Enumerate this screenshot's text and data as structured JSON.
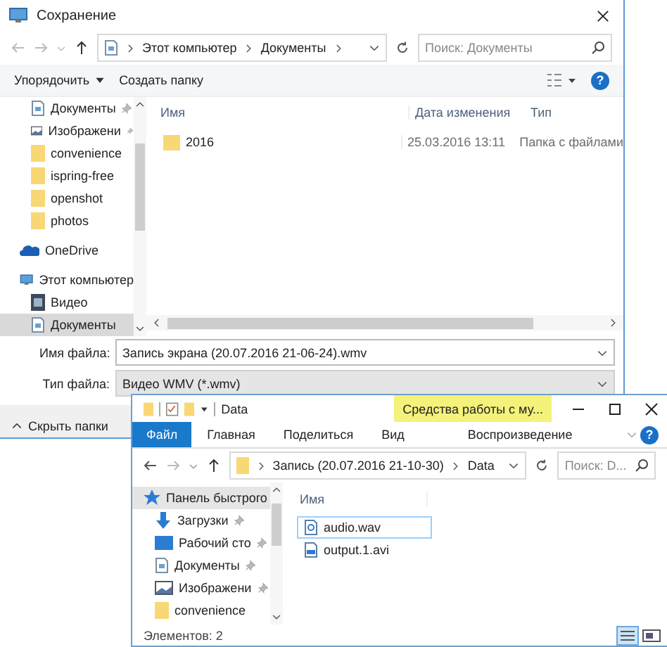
{
  "save_dialog": {
    "title": "Сохранение",
    "breadcrumb": [
      "Этот компьютер",
      "Документы"
    ],
    "search": {
      "placeholder": "Поиск: Документы"
    },
    "toolbar": {
      "organize": "Упорядочить",
      "new_folder": "Создать папку"
    },
    "nav": [
      {
        "kind": "group",
        "children": [
          {
            "label": "Документы",
            "kind": "documents",
            "pinned": true,
            "selected": false
          },
          {
            "label": "Изображени",
            "kind": "pictures",
            "pinned": true,
            "selected": false
          },
          {
            "label": "convenience",
            "kind": "folder",
            "pinned": false,
            "selected": false
          },
          {
            "label": "ispring-free",
            "kind": "folder",
            "pinned": false,
            "selected": false
          },
          {
            "label": "openshot",
            "kind": "folder",
            "pinned": false,
            "selected": false
          },
          {
            "label": "photos",
            "kind": "folder",
            "pinned": false,
            "selected": false
          }
        ]
      },
      {
        "label": "OneDrive",
        "kind": "onedrive",
        "selected": false
      },
      {
        "label": "Этот компьютер",
        "kind": "computer",
        "selected": false,
        "children": [
          {
            "label": "Видео",
            "kind": "video",
            "pinned": false,
            "selected": false
          },
          {
            "label": "Документы",
            "kind": "documents",
            "pinned": false,
            "selected": true
          }
        ]
      }
    ],
    "columns": [
      "Имя",
      "Дата изменения",
      "Тип"
    ],
    "rows": [
      {
        "name": "2016",
        "date": "25.03.2016 13:11",
        "type": "Папка с файлами"
      }
    ],
    "filename": {
      "label": "Имя файла:",
      "value": "Запись экрана (20.07.2016 21-06-24).wmv"
    },
    "filetype": {
      "label": "Тип файла:",
      "value": "Видео WMV (*.wmv)"
    },
    "hide_folders": "Скрыть папки",
    "help": "?"
  },
  "explorer": {
    "title": "Data",
    "context_tab": "Средства работы с му...",
    "tabs": [
      {
        "label": "Файл",
        "selected": true
      },
      {
        "label": "Главная",
        "selected": false
      },
      {
        "label": "Поделиться",
        "selected": false
      },
      {
        "label": "Вид",
        "selected": false
      },
      {
        "label": "Воспроизведение",
        "selected": false
      }
    ],
    "breadcrumb": [
      "Запись (20.07.2016 21-10-30)",
      "Data"
    ],
    "search": {
      "placeholder": "Поиск: D..."
    },
    "nav": [
      {
        "label": "Панель быстрого",
        "kind": "star",
        "selected": true,
        "children": [
          {
            "label": "Загрузки",
            "kind": "download",
            "pinned": true,
            "selected": false
          },
          {
            "label": "Рабочий сто",
            "kind": "desktop",
            "pinned": true,
            "selected": false
          },
          {
            "label": "Документы",
            "kind": "documents",
            "pinned": true,
            "selected": false
          },
          {
            "label": "Изображени",
            "kind": "pictures",
            "pinned": true,
            "selected": false
          },
          {
            "label": "convenience",
            "kind": "folder",
            "pinned": false,
            "selected": false
          }
        ]
      }
    ],
    "column": "Имя",
    "files": [
      {
        "name": "audio.wav",
        "kind": "audio",
        "selected": true
      },
      {
        "name": "output.1.avi",
        "kind": "video-file",
        "selected": false
      }
    ],
    "status": "Элементов: 2",
    "help": "?"
  }
}
